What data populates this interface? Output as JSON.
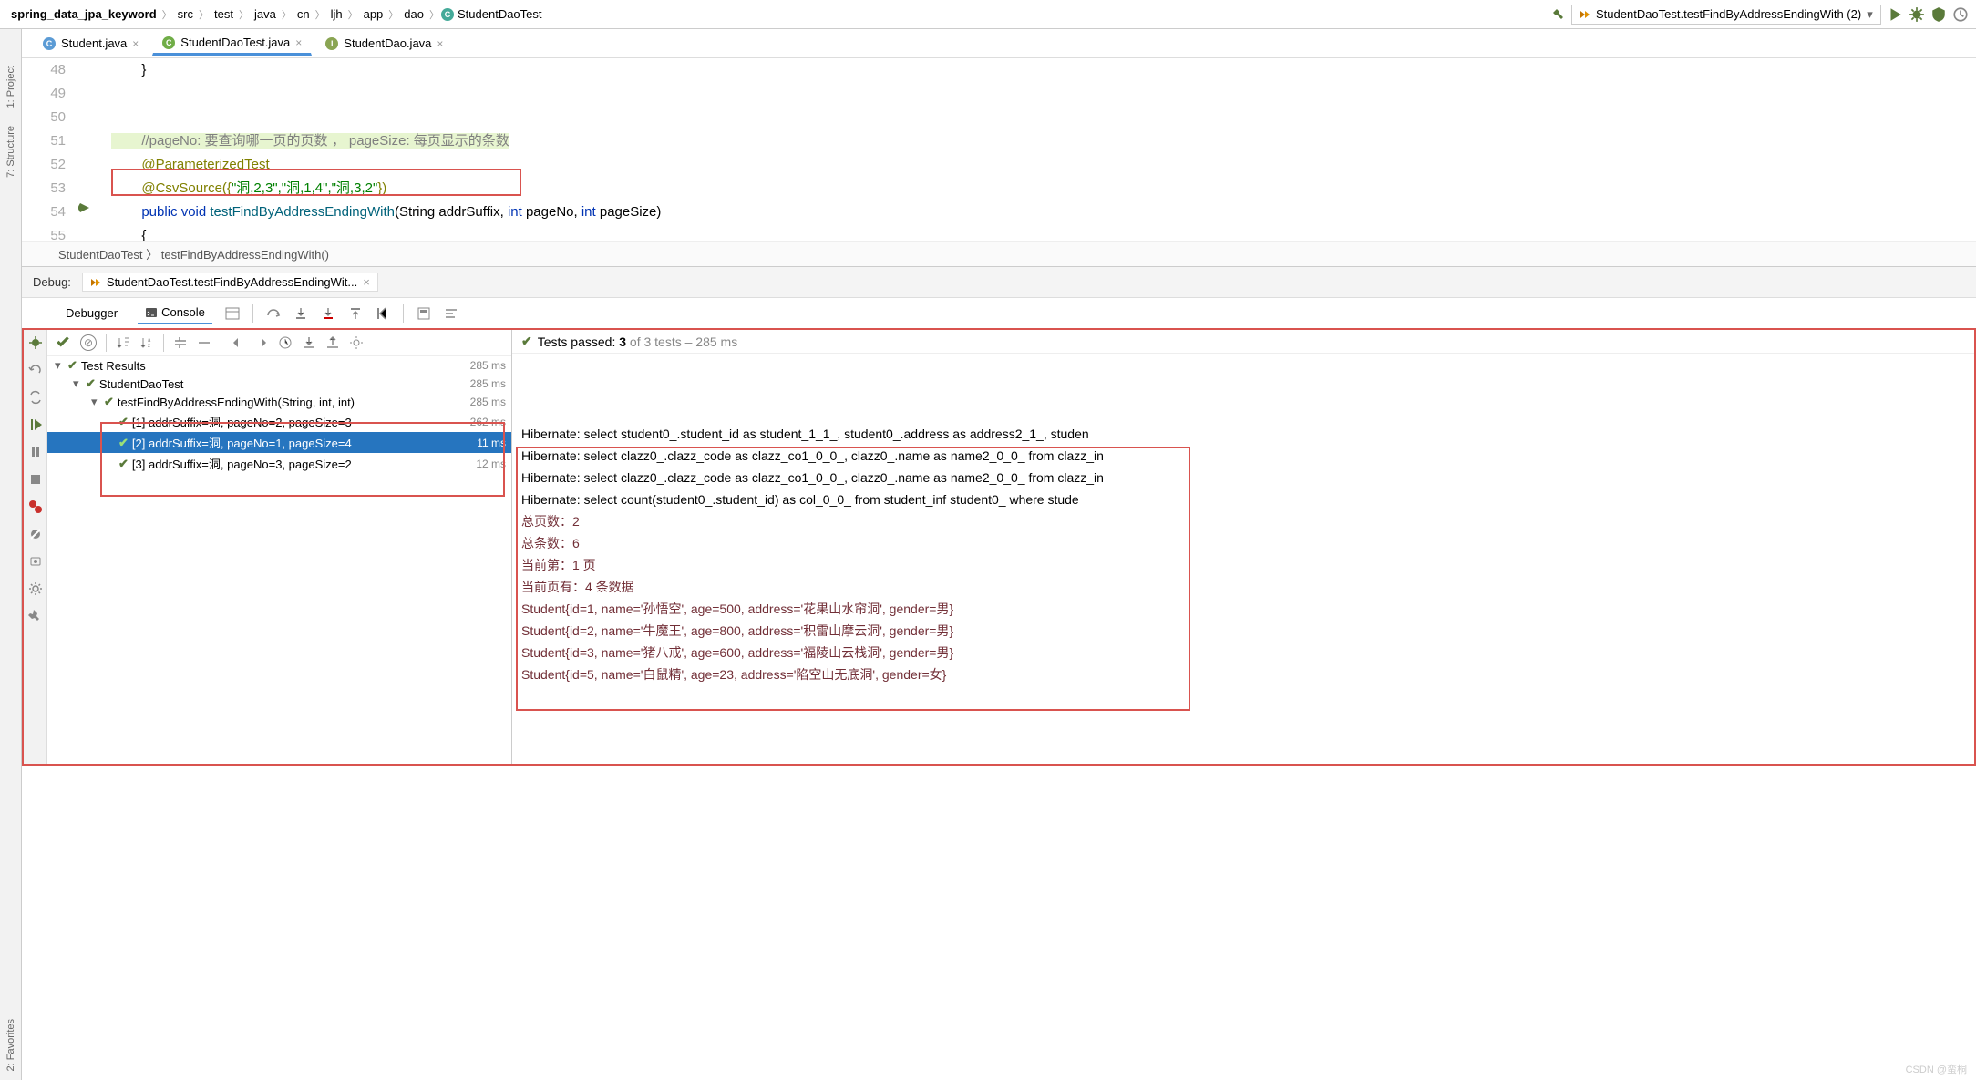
{
  "breadcrumb": {
    "project": "spring_data_jpa_keyword",
    "parts": [
      "src",
      "test",
      "java",
      "cn",
      "ljh",
      "app",
      "dao"
    ],
    "last": "StudentDaoTest"
  },
  "runConfig": {
    "name": "StudentDaoTest.testFindByAddressEndingWith (2)"
  },
  "fileTabs": [
    {
      "name": "Student.java",
      "iconLetter": "C",
      "iconClass": "java-c",
      "active": false
    },
    {
      "name": "StudentDaoTest.java",
      "iconLetter": "C",
      "iconClass": "java-test",
      "active": true
    },
    {
      "name": "StudentDao.java",
      "iconLetter": "I",
      "iconClass": "java-i",
      "active": false
    }
  ],
  "code": {
    "lines": [
      {
        "num": "48",
        "text": "        }"
      },
      {
        "num": "49",
        "text": ""
      },
      {
        "num": "50",
        "text": ""
      },
      {
        "num": "51",
        "comment": "        //pageNo: 要查询哪一页的页数 ， pageSize: 每页显示的条数"
      },
      {
        "num": "52",
        "anno": "        @ParameterizedTest"
      },
      {
        "num": "53",
        "csv_prefix": "        @CsvSource({",
        "csv_strings": "\"洞,2,3\",\"洞,1,4\",\"洞,3,2\"",
        "csv_suffix": "})"
      },
      {
        "num": "54",
        "sig_public": "        public ",
        "sig_void": "void ",
        "sig_name": "testFindByAddressEndingWith",
        "sig_params": "(String addrSuffix, ",
        "sig_int1": "int",
        "sig_page": " pageNo, ",
        "sig_int2": "int",
        "sig_ps": " pageSize)"
      },
      {
        "num": "55",
        "text": "        {"
      }
    ]
  },
  "methodPath": {
    "class": "StudentDaoTest",
    "method": "testFindByAddressEndingWith()"
  },
  "debugPanel": {
    "label": "Debug:",
    "tabName": "StudentDaoTest.testFindByAddressEndingWit..."
  },
  "toolTabs": {
    "debugger": "Debugger",
    "console": "Console"
  },
  "testsPassed": {
    "prefix": "Tests passed: ",
    "count": "3",
    "of": " of 3 tests",
    "time": " – 285 ms"
  },
  "testTree": {
    "root": {
      "label": "Test Results",
      "ms": "285 ms"
    },
    "class": {
      "label": "StudentDaoTest",
      "ms": "285 ms"
    },
    "method": {
      "label": "testFindByAddressEndingWith(String, int, int)",
      "ms": "285 ms"
    },
    "cases": [
      {
        "label": "[1] addrSuffix=洞, pageNo=2, pageSize=3",
        "ms": "262 ms",
        "selected": false
      },
      {
        "label": "[2] addrSuffix=洞, pageNo=1, pageSize=4",
        "ms": "11 ms",
        "selected": true
      },
      {
        "label": "[3] addrSuffix=洞, pageNo=3, pageSize=2",
        "ms": "12 ms",
        "selected": false
      }
    ]
  },
  "console": {
    "plainLines": [
      "Hibernate: select student0_.student_id as student_1_1_, student0_.address as address2_1_, studen",
      "Hibernate: select clazz0_.clazz_code as clazz_co1_0_0_, clazz0_.name as name2_0_0_ from clazz_in",
      "Hibernate: select clazz0_.clazz_code as clazz_co1_0_0_, clazz0_.name as name2_0_0_ from clazz_in",
      "Hibernate: select count(student0_.student_id) as col_0_0_ from student_inf student0_ where stude"
    ],
    "highlightedLines": [
      "总页数：2",
      "总条数：6",
      "当前第：1 页",
      "当前页有：4 条数据",
      "Student{id=1, name='孙悟空', age=500, address='花果山水帘洞', gender=男}",
      "Student{id=2, name='牛魔王', age=800, address='积雷山摩云洞', gender=男}",
      "Student{id=3, name='猪八戒', age=600, address='福陵山云栈洞', gender=男}",
      "Student{id=5, name='白鼠精', age=23, address='陷空山无底洞', gender=女}"
    ]
  },
  "leftRail": {
    "project": "1: Project",
    "structure": "7: Structure",
    "favorites": "2: Favorites"
  },
  "watermark": "CSDN @蛮桐"
}
